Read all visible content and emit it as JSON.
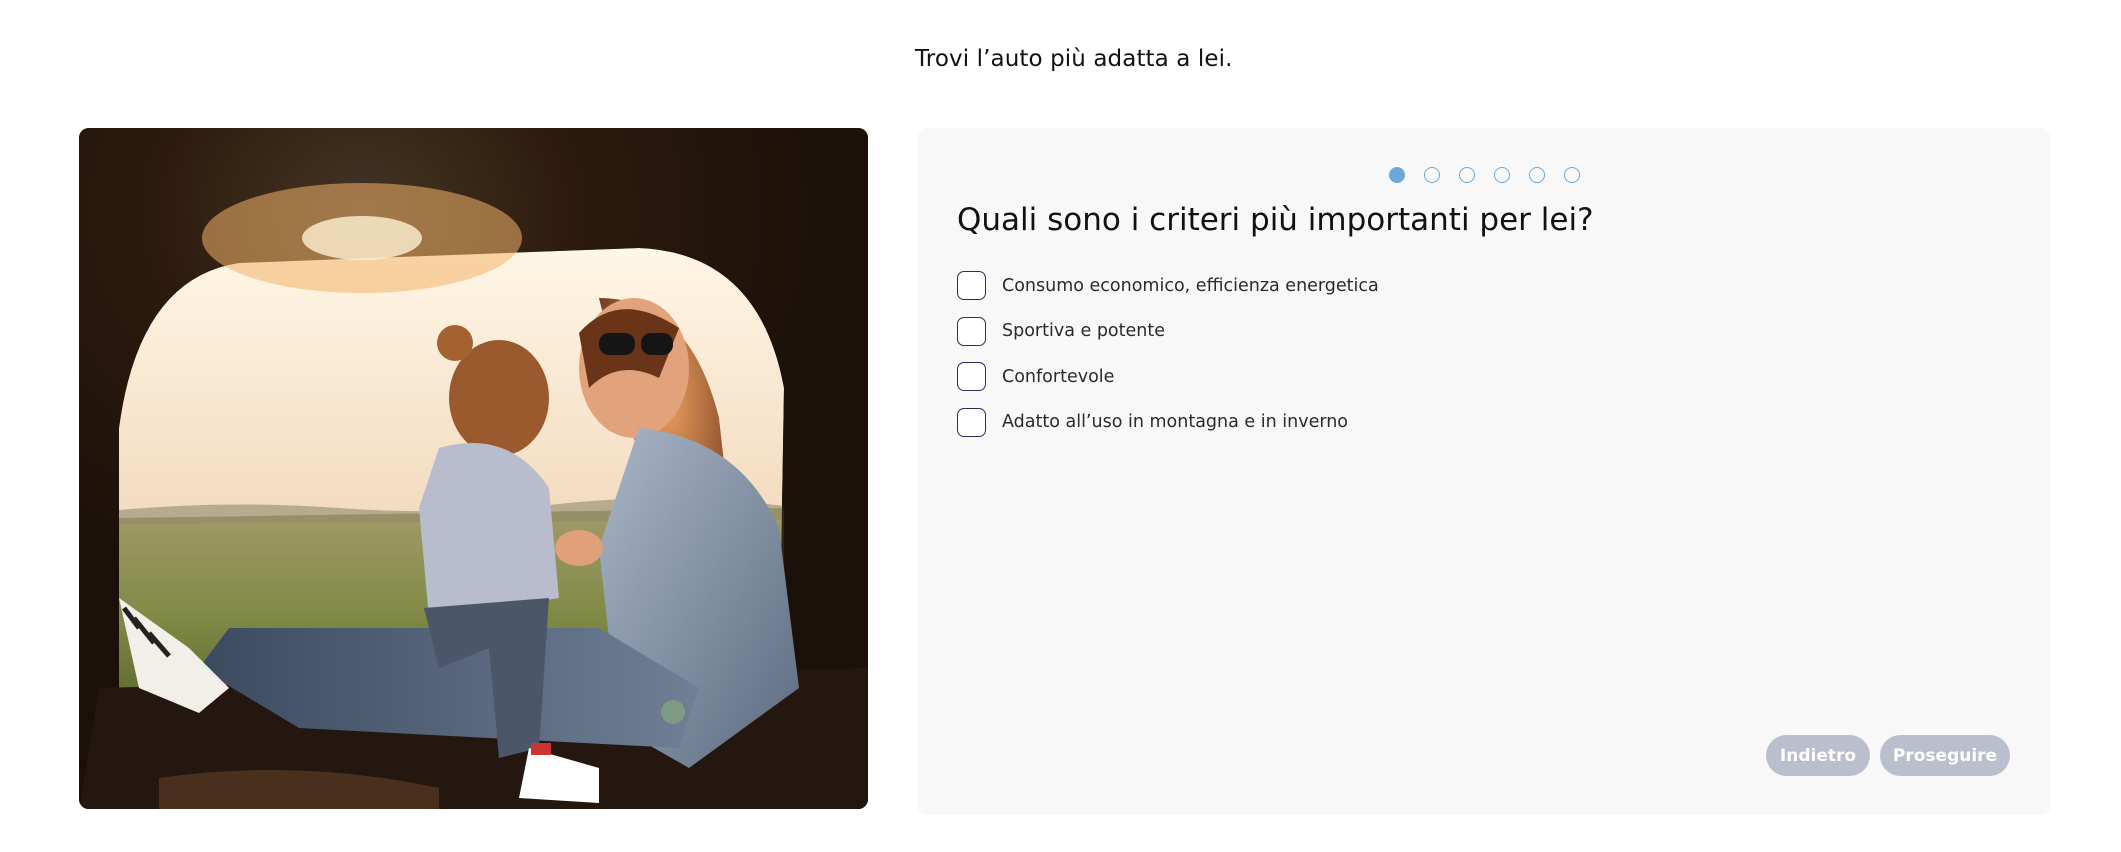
{
  "page": {
    "title": "Trovi l’auto più adatta a lei."
  },
  "photo": {
    "alt": "Madre e figlia sedute nel bagagliaio di un’auto al tramonto"
  },
  "quiz": {
    "progress": {
      "total_steps": 6,
      "current_step": 1
    },
    "question": "Quali sono i criteri più importanti per lei?",
    "options": [
      {
        "label": "Consumo economico, efficienza energetica",
        "checked": false
      },
      {
        "label": "Sportiva e potente",
        "checked": false
      },
      {
        "label": "Confortevole",
        "checked": false
      },
      {
        "label": "Adatto all’uso in montagna e in inverno",
        "checked": false
      }
    ],
    "buttons": {
      "back_label": "Indietro",
      "next_label": "Proseguire"
    }
  },
  "colors": {
    "progress_accent": "#6ea8d6",
    "checkbox_border": "#2b2f5a",
    "button_disabled": "#b9bfcd",
    "card_background": "#f8f8f8"
  }
}
